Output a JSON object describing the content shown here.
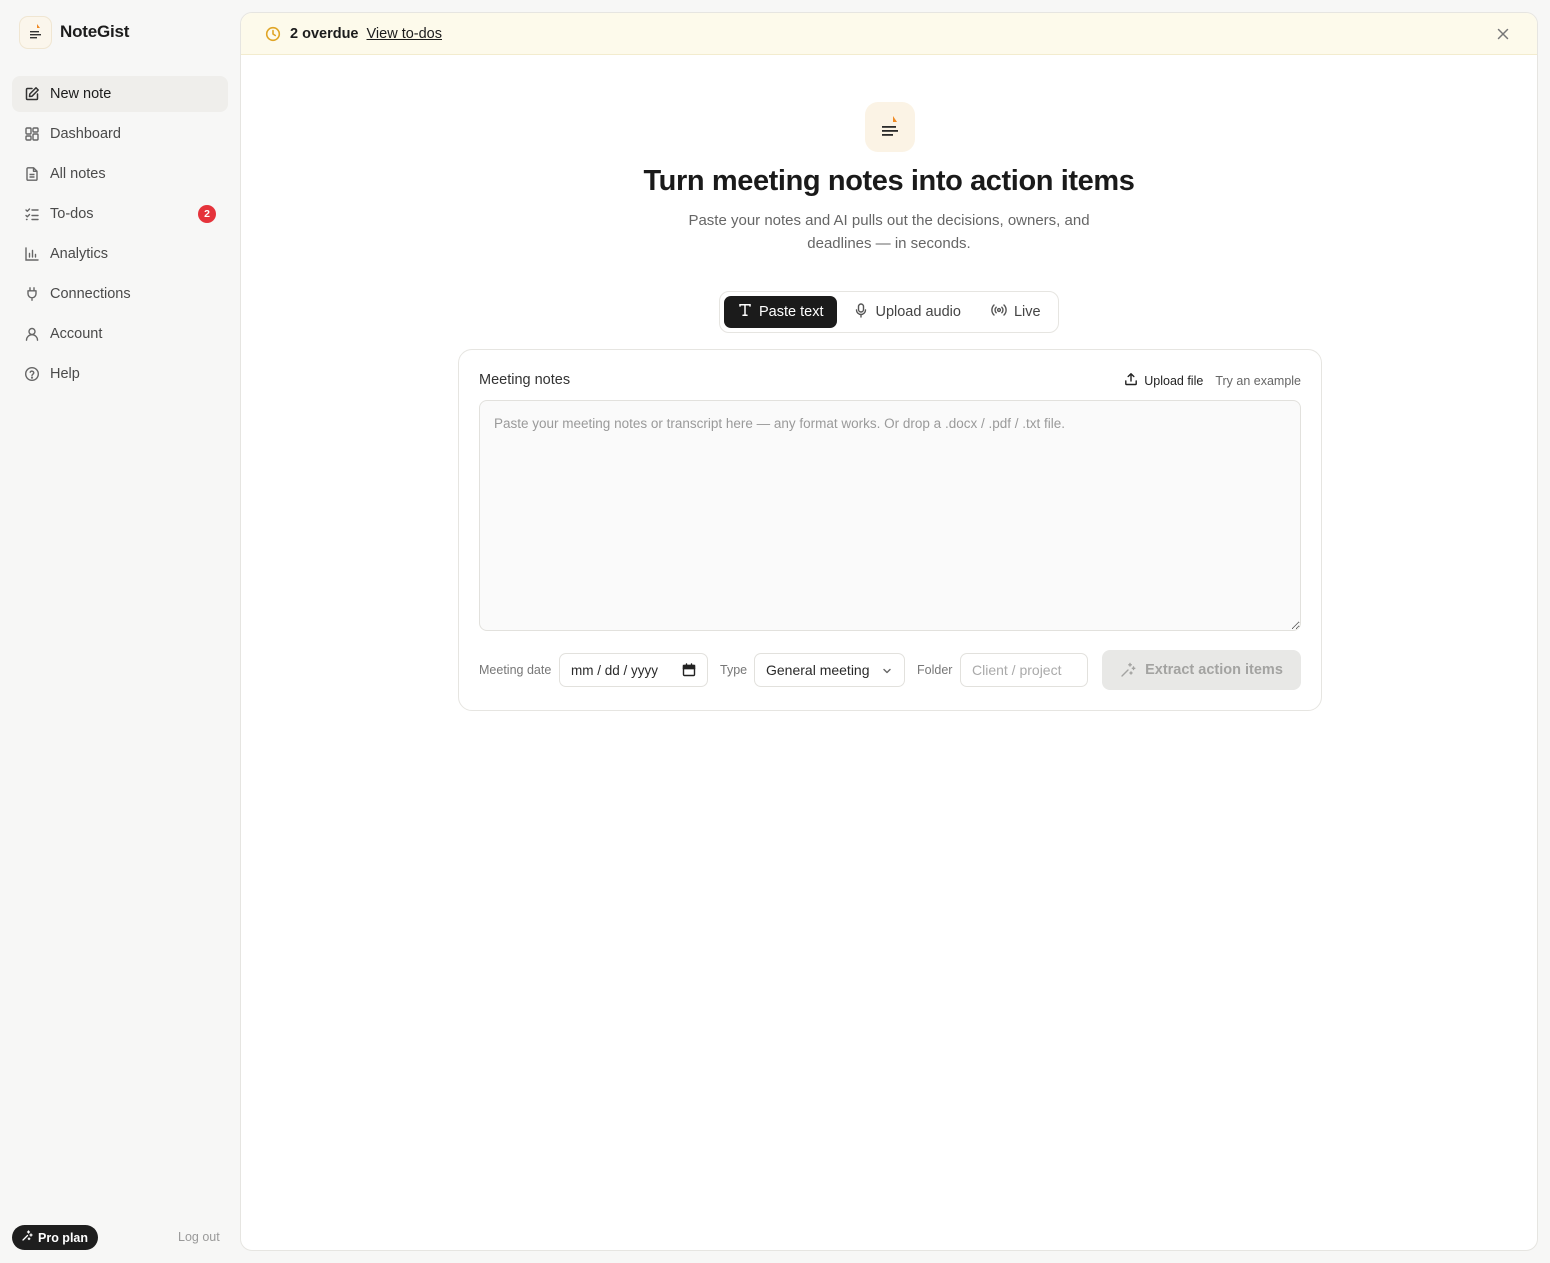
{
  "brand": {
    "name": "NoteGist",
    "icon": "note-logo-icon"
  },
  "sidebar": {
    "items": [
      {
        "label": "New note",
        "icon": "edit-icon",
        "active": true
      },
      {
        "label": "Dashboard",
        "icon": "dashboard-icon"
      },
      {
        "label": "All notes",
        "icon": "document-icon"
      },
      {
        "label": "To-dos",
        "icon": "checklist-icon",
        "badge": "2"
      },
      {
        "label": "Analytics",
        "icon": "bar-chart-icon"
      },
      {
        "label": "Connections",
        "icon": "plug-icon"
      },
      {
        "label": "Account",
        "icon": "user-icon"
      },
      {
        "label": "Help",
        "icon": "help-icon"
      }
    ],
    "plan_label": "Pro plan",
    "logout_label": "Log out"
  },
  "banner": {
    "text": "2 overdue",
    "link": "View to-dos",
    "accent": "#e0a526"
  },
  "hero": {
    "title": "Turn meeting notes into action items",
    "subtitle": "Paste your notes and AI pulls out the decisions, owners, and deadlines — in seconds."
  },
  "modes": [
    {
      "label": "Paste text",
      "icon": "text-icon",
      "active": true
    },
    {
      "label": "Upload audio",
      "icon": "microphone-icon"
    },
    {
      "label": "Live",
      "icon": "broadcast-icon"
    }
  ],
  "card": {
    "label": "Meeting notes",
    "upload_label": "Upload file",
    "example_label": "Try an example",
    "textarea_placeholder": "Paste your meeting notes or transcript here — any format works. Or drop a .docx / .pdf / .txt file.",
    "date_label": "Meeting date",
    "date_placeholder": "mm / dd / yyyy",
    "type_label": "Type",
    "type_value": "General meeting",
    "folder_label": "Folder",
    "folder_placeholder": "Client / project",
    "submit_label": "Extract action items"
  },
  "colors": {
    "badge": "#e5333b",
    "primary_dark": "#1b1b1b",
    "banner_bg": "#fdfaeb"
  }
}
